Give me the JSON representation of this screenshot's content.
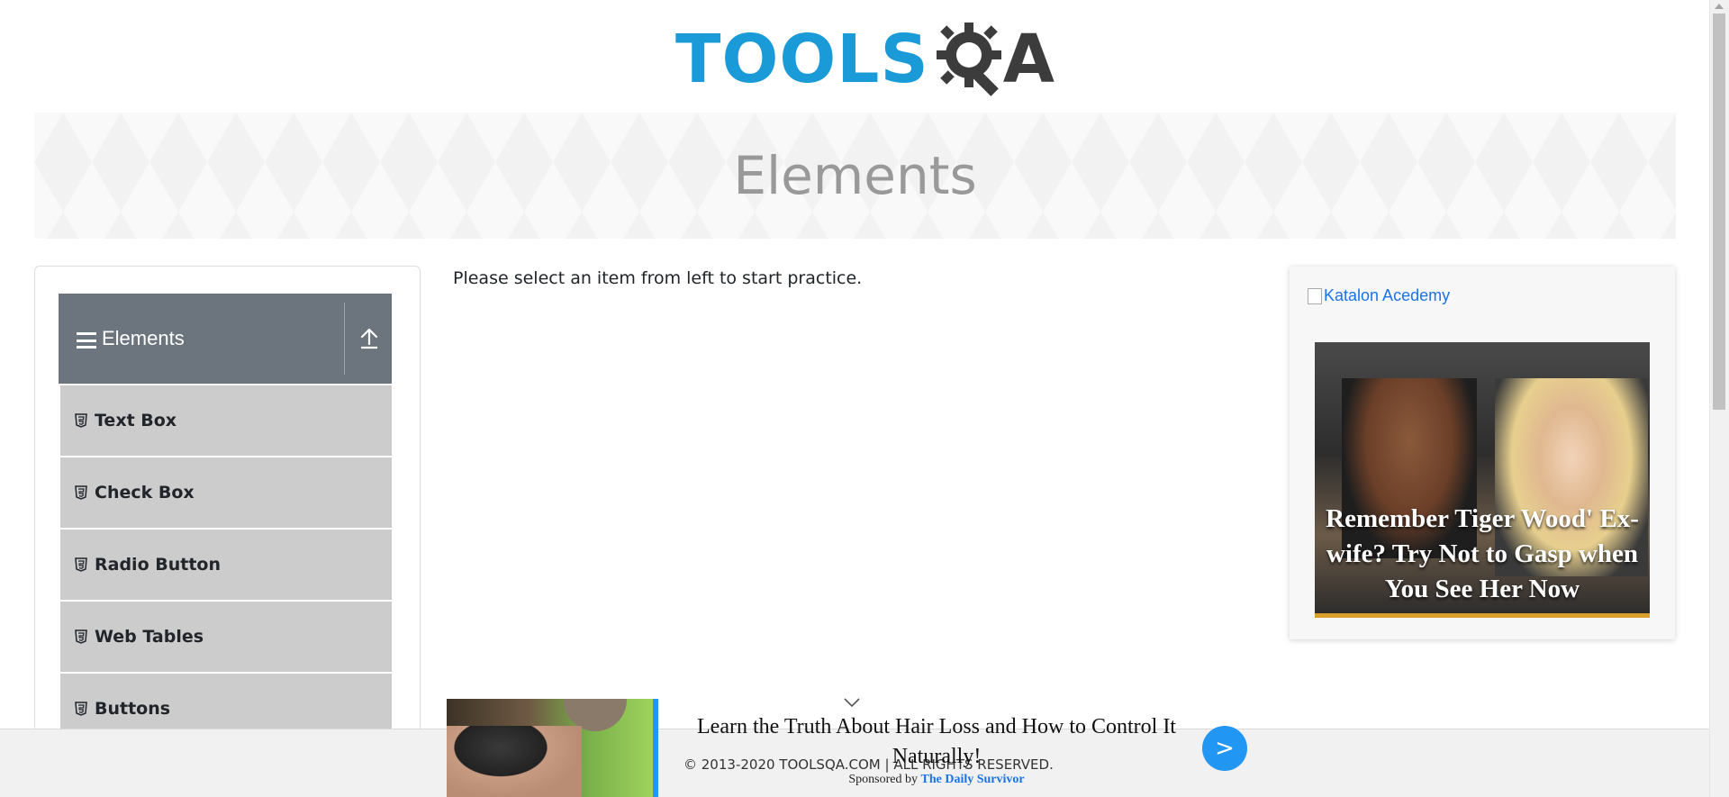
{
  "header": {
    "logo_text": "TOOLS",
    "logo_suffix": "A",
    "logo_icon": "gear-magnifier-icon"
  },
  "banner": {
    "title": "Elements"
  },
  "sidebar": {
    "group_title": "Elements",
    "group_icon": "hamburger-icon",
    "collapse_icon": "upload-arrow-icon",
    "items": [
      {
        "label": "Text Box",
        "icon": "html5-icon"
      },
      {
        "label": "Check Box",
        "icon": "html5-icon"
      },
      {
        "label": "Radio Button",
        "icon": "html5-icon"
      },
      {
        "label": "Web Tables",
        "icon": "html5-icon"
      },
      {
        "label": "Buttons",
        "icon": "html5-icon"
      }
    ]
  },
  "main": {
    "message": "Please select an item from left to start practice."
  },
  "ad_card": {
    "alt_text": "Katalon Acedemy",
    "headline": "Remember Tiger Wood' Ex-wife? Try Not to Gasp when You See Her Now",
    "accent_color": "#d9a12b"
  },
  "bottom_ad": {
    "title": "Learn the Truth About Hair Loss and How to Control It Naturally!",
    "sponsor_prefix": "Sponsored by",
    "sponsor_name": "The Daily Survivor",
    "go_label": ">",
    "accent_color": "#2196f3"
  },
  "footer": {
    "copyright": "© 2013-2020 TOOLSQA.COM | ALL RIGHTS RESERVED."
  },
  "colors": {
    "brand_blue": "#1a9bd7",
    "sidebar_header": "#6c757d",
    "menu_item_bg": "#cccccc"
  }
}
